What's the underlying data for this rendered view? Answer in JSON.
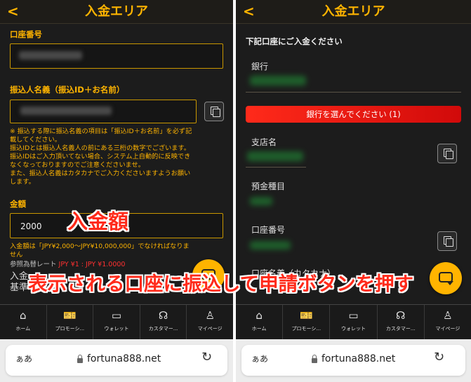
{
  "left": {
    "header": {
      "back": "<",
      "title": "入金エリア"
    },
    "account_number_label": "口座番号",
    "payer_name_label": "振込人名義（振込ID＋お名前）",
    "notes": [
      "※ 振込する際に振込名義の項目は「振込ID＋お名前」を必ず記",
      "載してください。",
      "振込IDとは振込人名義人の前にある三桁の数字でございます。",
      "振込IDはご入力頂いてない場合、システム上自動的に反映でき",
      "なくなっておりますのでご注意くださいませ。",
      "また、振込人名義はカタカナでご入力くださいますようお願い",
      "します。"
    ],
    "amount_label": "金額",
    "amount_value": "2000",
    "amount_note_1": "入金額は「JPY¥2,000～JPY¥10,000,000」でなければなりま",
    "amount_note_2": "せん",
    "rate_label": "参照為替レート",
    "rate_value": "JPY ¥1 : JPY ¥1.0000",
    "cut_line_1": "入金",
    "cut_line_2": "基準"
  },
  "right": {
    "header": {
      "back": "<",
      "title": "入金エリア"
    },
    "section_title": "下記口座にご入金ください",
    "bank_label": "銀行",
    "select_bank_button": "銀行を選んでください (1)",
    "branch_label": "支店名",
    "deposit_type_label": "預金種目",
    "account_number_label": "口座番号",
    "account_name_label": "口座名義（カタカナ）"
  },
  "nav": [
    {
      "icon": "home-icon",
      "label": "ホーム"
    },
    {
      "icon": "promotion-ticket-icon",
      "label": "プロモーシ..."
    },
    {
      "icon": "wallet-icon",
      "label": "ウォレット"
    },
    {
      "icon": "headset-icon",
      "label": "カスタマー..."
    },
    {
      "icon": "user-icon",
      "label": "マイページ"
    }
  ],
  "browser": {
    "aa": "ぁあ",
    "url": "fortuna888.net"
  },
  "annotations": {
    "amount": "入金額",
    "instruction": "表示される口座に振込して申請ボタンを押す"
  },
  "colors": {
    "accent": "#ffb400",
    "annotation": "#ff2a1a",
    "button_red": "#e01010",
    "background": "#1c1c1c"
  }
}
